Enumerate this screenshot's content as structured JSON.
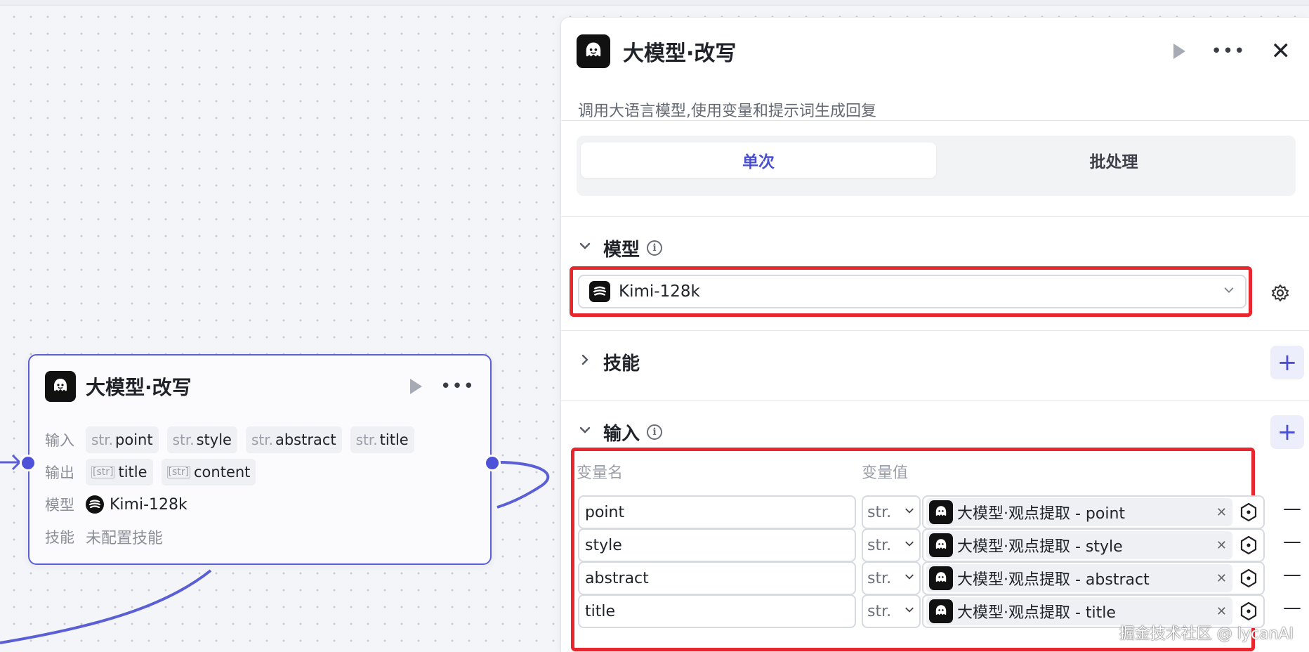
{
  "node": {
    "title": "大模型·改写",
    "input_label": "输入",
    "inputs": [
      {
        "type": "str.",
        "name": "point"
      },
      {
        "type": "str.",
        "name": "style"
      },
      {
        "type": "str.",
        "name": "abstract"
      },
      {
        "type": "str.",
        "name": "title"
      }
    ],
    "output_label": "输出",
    "outputs": [
      {
        "type": "[str]",
        "name": "title"
      },
      {
        "type": "[str]",
        "name": "content"
      }
    ],
    "model_label": "模型",
    "model": "Kimi-128k",
    "skill_label": "技能",
    "skill_value": "未配置技能"
  },
  "panel": {
    "title": "大模型·改写",
    "description": "调用大语言模型,使用变量和提示词生成回复",
    "tabs": [
      "单次",
      "批处理"
    ],
    "active_tab": "单次",
    "model_section": "模型",
    "model_selected": "Kimi-128k",
    "skills_section": "技能",
    "input_section": "输入",
    "col_name": "变量名",
    "col_value": "变量值",
    "variables": [
      {
        "name": "point",
        "type": "str.",
        "ref": "大模型·观点提取 - point"
      },
      {
        "name": "style",
        "type": "str.",
        "ref": "大模型·观点提取 - style"
      },
      {
        "name": "abstract",
        "type": "str.",
        "ref": "大模型·观点提取 - abstract"
      },
      {
        "name": "title",
        "type": "str.",
        "ref": "大模型·观点提取 - title"
      }
    ]
  },
  "watermark": "掘金技术社区 @ lycanAI",
  "colors": {
    "accent": "#4e52d8",
    "highlight_box": "#e8262d",
    "canvas_bg": "#f4f5f8"
  }
}
